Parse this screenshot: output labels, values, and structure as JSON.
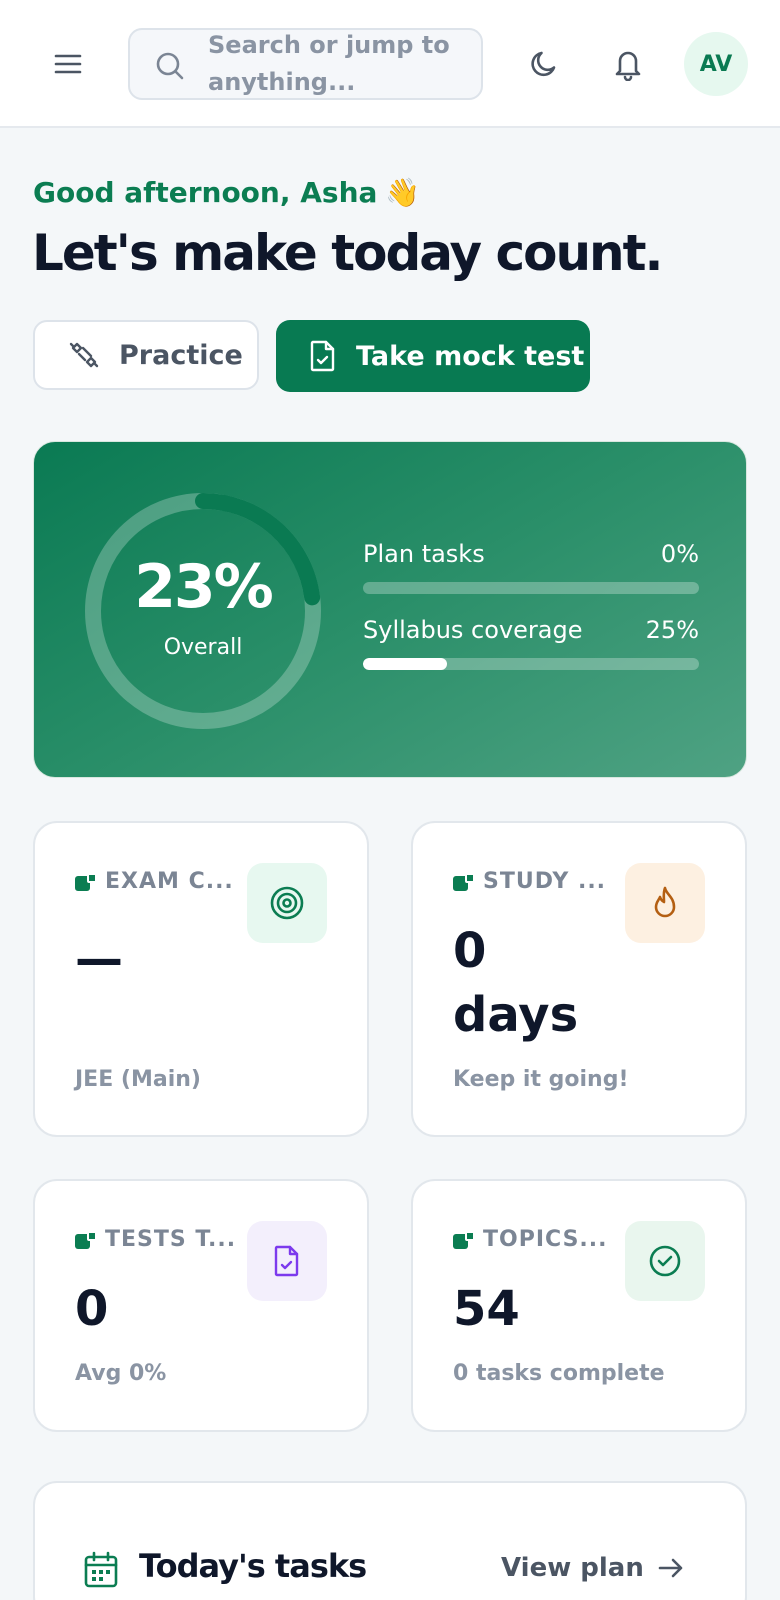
{
  "header": {
    "search_placeholder": "Search or jump to anything...",
    "avatar_initials": "AV",
    "icons": [
      "menu-icon",
      "search-icon",
      "moon-icon",
      "bell-icon"
    ]
  },
  "greeting": {
    "line": "Good afternoon, Asha",
    "emoji": "👋",
    "headline": "Let's make today count."
  },
  "actions": {
    "practice_label": "Practice",
    "mock_test_label": "Take mock test"
  },
  "progress": {
    "overall_value": "23%",
    "overall_fraction": 0.23,
    "overall_label": "Overall",
    "bars": [
      {
        "label": "Plan tasks",
        "value": "0%",
        "fraction": 0.0
      },
      {
        "label": "Syllabus coverage",
        "value": "25%",
        "fraction": 0.25
      }
    ]
  },
  "stats": [
    {
      "label": "EXAM C...",
      "value": "—",
      "sub": "JEE (Main)",
      "icon": "target-icon",
      "icon_bg": "#e7f8f0",
      "icon_color": "#0b7d52"
    },
    {
      "label": "STUDY ...",
      "value_line1": "0",
      "value_line2": "days",
      "sub": "Keep it going!",
      "icon": "flame-icon",
      "icon_bg": "#fdf0e1",
      "icon_color": "#b45f12"
    },
    {
      "label": "TESTS T...",
      "value": "0",
      "sub": "Avg 0%",
      "icon": "file-check-icon",
      "icon_bg": "#f3effc",
      "icon_color": "#7c3aed"
    },
    {
      "label": "TOPICS...",
      "value": "54",
      "sub": "0 tasks complete",
      "icon": "check-circle-icon",
      "icon_bg": "#e9f6ee",
      "icon_color": "#0b7d52"
    }
  ],
  "tasks": {
    "title": "Today's tasks",
    "view_plan_label": "View plan"
  },
  "colors": {
    "brand": "#087a52",
    "text": "#0f172a",
    "muted": "#8a94a3"
  }
}
